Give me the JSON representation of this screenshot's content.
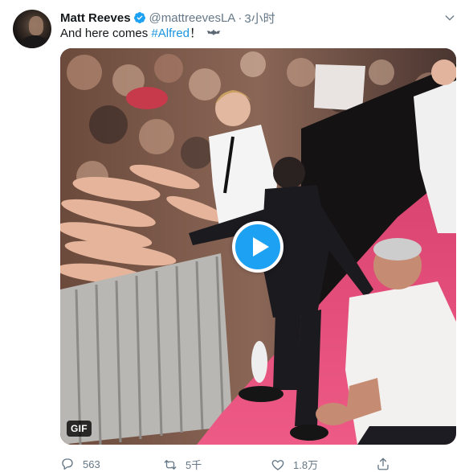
{
  "tweet": {
    "author_name": "Matt Reeves",
    "handle": "@mattreevesLA",
    "separator": "·",
    "time": "3小时",
    "text_prefix": "And here comes ",
    "hashtag": "#Alfred",
    "text_suffix": "！",
    "emoji_icon": "bat-icon",
    "verified_icon": "verified-badge-icon",
    "menu_icon": "chevron-down-icon"
  },
  "media": {
    "badge": "GIF",
    "play_icon": "play-icon"
  },
  "actions": {
    "reply_count": "563",
    "retweet_count": "5千",
    "like_count": "1.8万",
    "reply_icon": "reply-icon",
    "retweet_icon": "retweet-icon",
    "like_icon": "heart-icon",
    "share_icon": "share-icon"
  },
  "colors": {
    "accent": "#1da1f2",
    "hashtag": "#1b95e0",
    "secondary_text": "#657786",
    "carpet": "#e84a7a"
  }
}
